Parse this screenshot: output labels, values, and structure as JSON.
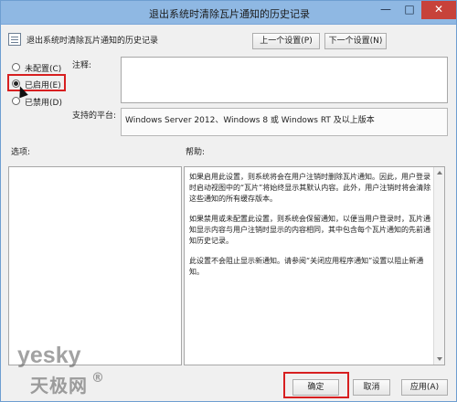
{
  "window": {
    "title": "退出系统时清除瓦片通知的历史记录",
    "controls": {
      "minimize": "—",
      "maximize": "□",
      "close": "✕"
    }
  },
  "header": {
    "title": "退出系统时清除瓦片通知的历史记录",
    "prev_label": "上一个设置(P)",
    "next_label": "下一个设置(N)"
  },
  "radios": [
    {
      "label": "未配置(C)",
      "selected": false
    },
    {
      "label": "已启用(E)",
      "selected": true
    },
    {
      "label": "已禁用(D)",
      "selected": false
    }
  ],
  "fields": {
    "comment_label": "注释:",
    "comment_value": "",
    "platform_label": "支持的平台:",
    "platform_value": "Windows Server 2012、Windows 8 或 Windows RT 及以上版本"
  },
  "sections": {
    "options": "选项:",
    "help": "帮助:"
  },
  "help": {
    "paragraphs": [
      "如果启用此设置，则系统将会在用户注销时删除瓦片通知。因此，用户登录时启动视图中的“瓦片”将始终显示其默认内容。此外，用户注销时将会清除这些通知的所有缓存版本。",
      "如果禁用或未配置此设置，则系统会保留通知，以便当用户登录时，瓦片通知显示内容与用户注销时显示的内容相同，其中包含每个瓦片通知的先前通知历史记录。",
      "此设置不会阻止显示新通知。请参阅“关闭应用程序通知”设置以阻止新通知。"
    ]
  },
  "footer": {
    "ok": "确定",
    "cancel": "取消",
    "apply": "应用(A)"
  },
  "watermark": {
    "top": "yesky",
    "bottom": "天极网",
    "mark": "®"
  },
  "colors": {
    "titlebar": "#8fb8e3",
    "highlight": "#d71f20",
    "close_button": "#c7423a"
  }
}
